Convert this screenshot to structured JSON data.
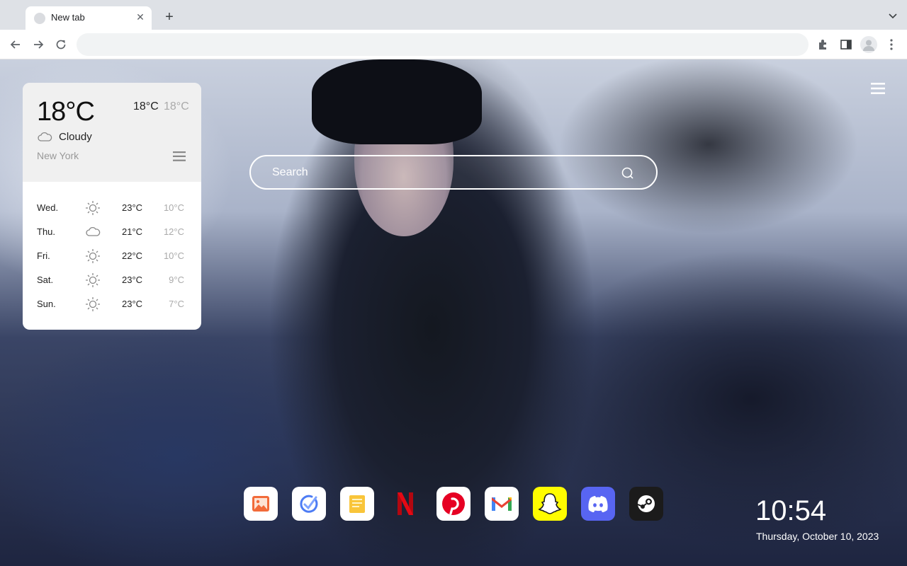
{
  "browser": {
    "tab_title": "New tab",
    "new_tab_label": "+",
    "close_label": "✕"
  },
  "weather": {
    "current_temp": "18°C",
    "high": "18°C",
    "low": "18°C",
    "condition": "Cloudy",
    "city": "New York",
    "forecast": [
      {
        "day": "Wed.",
        "icon": "sun-icon",
        "high": "23°C",
        "low": "10°C"
      },
      {
        "day": "Thu.",
        "icon": "cloud-icon",
        "high": "21°C",
        "low": "12°C"
      },
      {
        "day": "Fri.",
        "icon": "sun-icon",
        "high": "22°C",
        "low": "10°C"
      },
      {
        "day": "Sat.",
        "icon": "sun-icon",
        "high": "23°C",
        "low": "9°C"
      },
      {
        "day": "Sun.",
        "icon": "sun-icon",
        "high": "23°C",
        "low": "7°C"
      }
    ]
  },
  "search": {
    "placeholder": "Search"
  },
  "dock": [
    {
      "name": "photos",
      "icon": "photos-icon",
      "bg": "#ffffff"
    },
    {
      "name": "todo",
      "icon": "todo-icon",
      "bg": "#ffffff"
    },
    {
      "name": "notes",
      "icon": "notes-icon",
      "bg": "#ffffff"
    },
    {
      "name": "netflix",
      "icon": "netflix-icon",
      "bg": "transparent",
      "accent": "#e50914"
    },
    {
      "name": "pinterest",
      "icon": "pinterest-icon",
      "bg": "#ffffff",
      "accent": "#e60023"
    },
    {
      "name": "gmail",
      "icon": "gmail-icon",
      "bg": "#ffffff"
    },
    {
      "name": "snapchat",
      "icon": "snapchat-icon",
      "bg": "#fffc00"
    },
    {
      "name": "discord",
      "icon": "discord-icon",
      "bg": "#5865f2"
    },
    {
      "name": "steam",
      "icon": "steam-icon",
      "bg": "#1b1b1b"
    }
  ],
  "clock": {
    "time": "10:54",
    "date": "Thursday, October 10, 2023"
  }
}
